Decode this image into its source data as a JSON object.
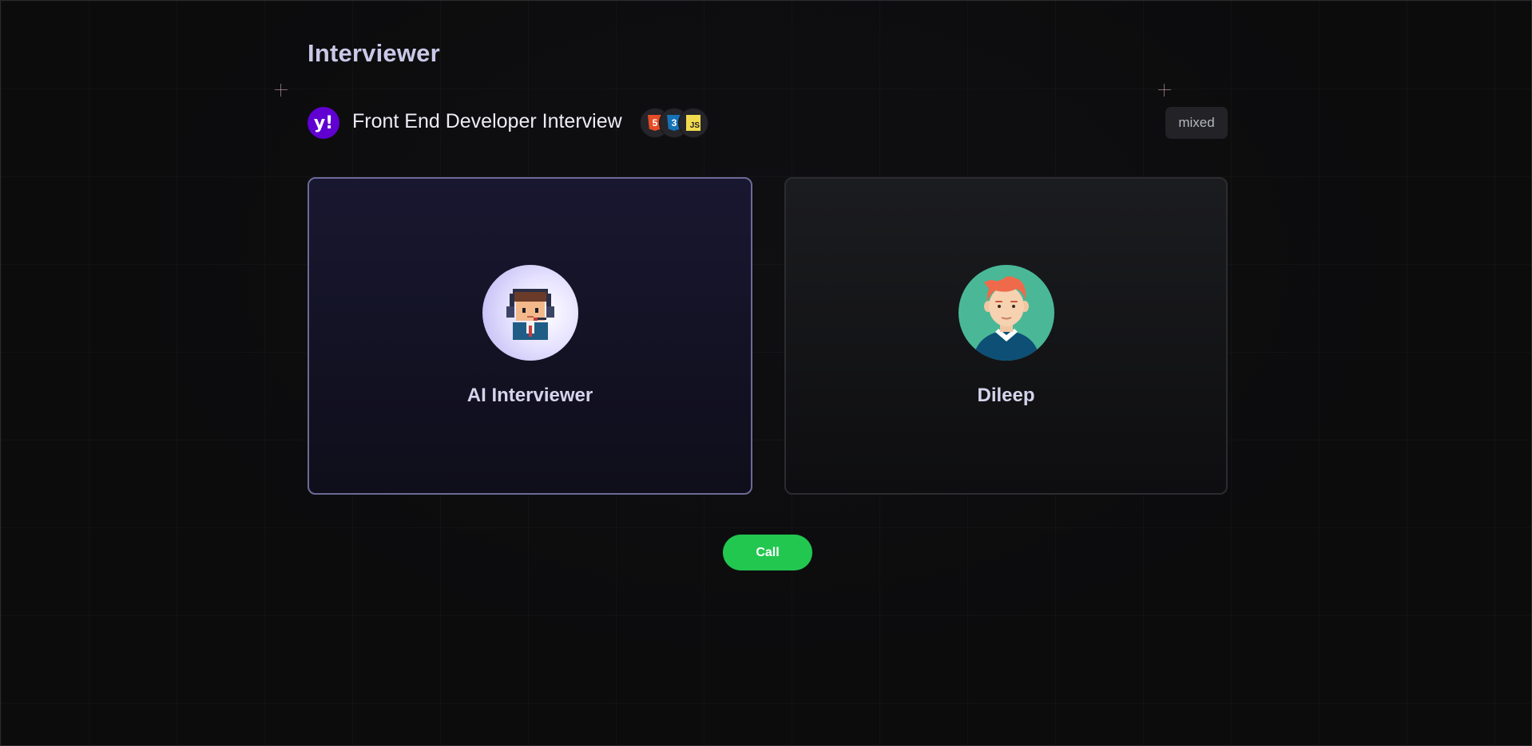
{
  "header": {
    "title": "Interviewer"
  },
  "interview": {
    "company_logo_text": "y!",
    "company_logo_icon": "yahoo-logo-icon",
    "company_color": "#6001d2",
    "job_title": "Front End Developer Interview",
    "tech_stack": [
      {
        "name": "html5-icon",
        "label": "5",
        "color": "#e44d26"
      },
      {
        "name": "css3-icon",
        "label": "3",
        "color": "#1572b6"
      },
      {
        "name": "javascript-icon",
        "label": "JS",
        "color": "#f0db4f"
      }
    ],
    "mode_badge": "mixed"
  },
  "participants": {
    "ai": {
      "name": "AI Interviewer",
      "avatar_icon": "pixel-interviewer-avatar-icon",
      "border_color": "#6c6a96"
    },
    "user": {
      "name": "Dileep",
      "avatar_icon": "user-avatar-icon",
      "avatar_bg": "#4ab896"
    }
  },
  "actions": {
    "call_label": "Call",
    "call_color": "#22c750"
  }
}
